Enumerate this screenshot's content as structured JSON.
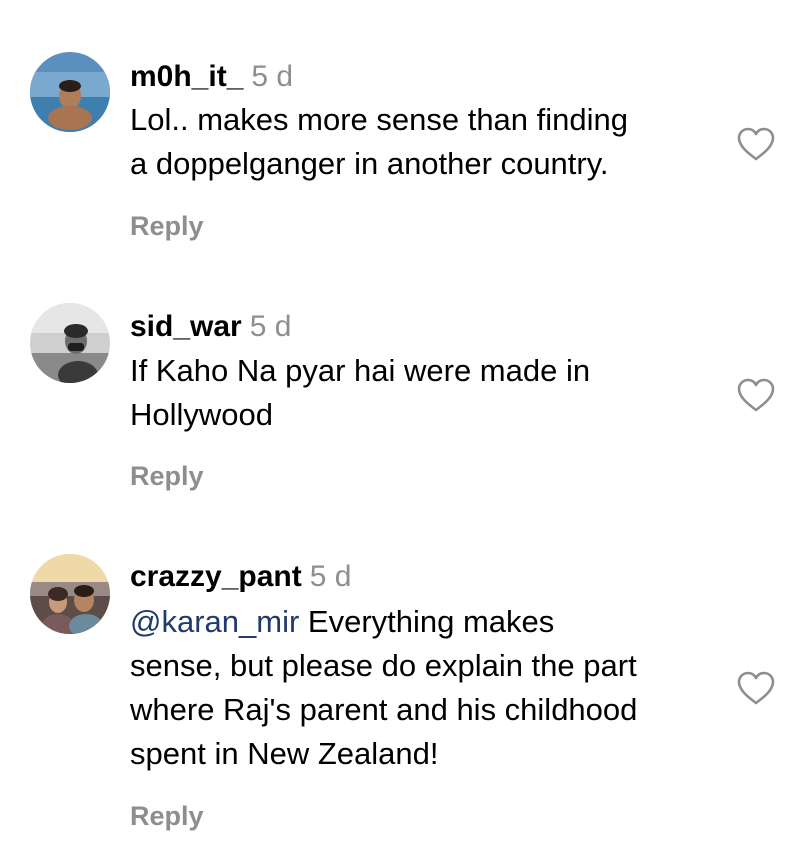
{
  "comments": [
    {
      "username": "m0h_it_",
      "time": "5 d",
      "text_lines": [
        "Lol.. makes more sense than finding",
        "a doppelganger in another country."
      ],
      "reply_label": "Reply",
      "avatar_icon": "avatar-photo-pool",
      "like_icon": "heart-outline-icon"
    },
    {
      "username": "sid_war",
      "time": "5 d",
      "text_lines": [
        "If Kaho Na pyar hai were made in",
        "Hollywood"
      ],
      "reply_label": "Reply",
      "avatar_icon": "avatar-photo-bw",
      "like_icon": "heart-outline-icon"
    },
    {
      "username": "crazzy_pant",
      "time": "5 d",
      "mention": "@karan_mir",
      "text_lines": [
        " Everything makes",
        "sense, but please do explain the part",
        "where Raj's parent and his childhood",
        "spent in New Zealand!"
      ],
      "reply_label": "Reply",
      "avatar_icon": "avatar-photo-couple",
      "like_icon": "heart-outline-icon"
    }
  ],
  "colors": {
    "text": "#000000",
    "muted": "#8e8e8e",
    "mention": "#1f3a6b",
    "background": "#ffffff"
  }
}
